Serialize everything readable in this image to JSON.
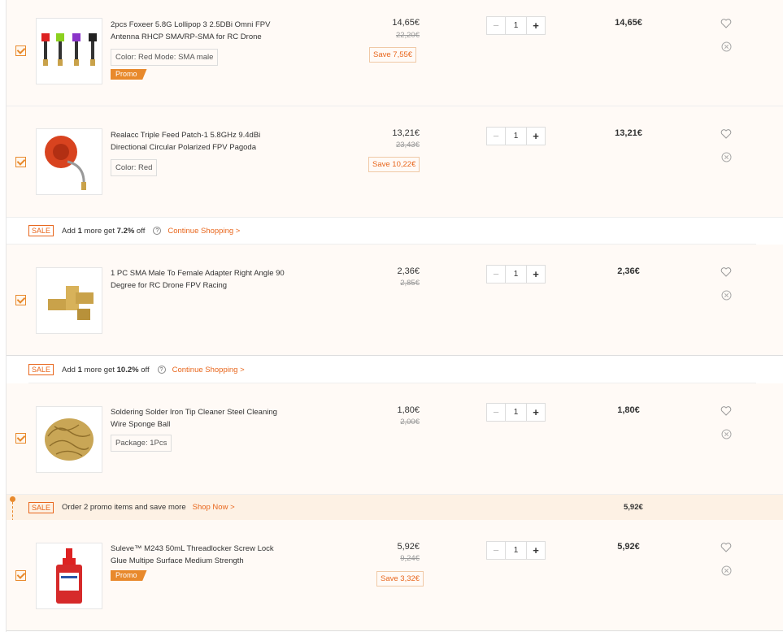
{
  "items": [
    {
      "title": "2pcs Foxeer 5.8G Lollipop 3 2.5DBi Omni FPV Antenna RHCP SMA/RP-SMA for RC Drone",
      "variant": "Color: Red Mode: SMA male",
      "promo": "Promo",
      "price": "14,65€",
      "old_price": "22,20€",
      "save": "Save 7,55€",
      "qty": "1",
      "subtotal": "14,65€",
      "thumb_icon": "antenna-set-image"
    },
    {
      "title": "Realacc Triple Feed Patch-1 5.8GHz 9.4dBi Directional Circular Polarized FPV Pagoda",
      "variant": "Color: Red",
      "price": "13,21€",
      "old_price": "23,43€",
      "save": "Save 10,22€",
      "qty": "1",
      "subtotal": "13,21€",
      "thumb_icon": "patch-antenna-image"
    },
    {
      "title": "1 PC SMA Male To Female Adapter Right Angle 90 Degree for RC Drone FPV Racing",
      "price": "2,36€",
      "old_price": "2,85€",
      "qty": "1",
      "subtotal": "2,36€",
      "thumb_icon": "sma-adapter-image"
    },
    {
      "title": "Soldering Solder Iron Tip Cleaner Steel Cleaning Wire Sponge Ball",
      "variant": "Package: 1Pcs",
      "price": "1,80€",
      "old_price": "2,00€",
      "qty": "1",
      "subtotal": "1,80€",
      "thumb_icon": "wire-sponge-image"
    },
    {
      "title": "Suleve™ M243 50mL Threadlocker Screw Lock Glue Multipe Surface Medium Strength",
      "promo": "Promo",
      "price": "5,92€",
      "old_price": "9,24€",
      "save": "Save 3,32€",
      "qty": "1",
      "subtotal": "5,92€",
      "thumb_icon": "threadlocker-bottle-image"
    }
  ],
  "sale_bars": [
    {
      "badge": "SALE",
      "prefix": "Add ",
      "count": "1",
      "middle": " more get ",
      "discount": "7.2%",
      "suffix": " off",
      "link": "Continue Shopping >"
    },
    {
      "badge": "SALE",
      "prefix": "Add ",
      "count": "1",
      "middle": " more get ",
      "discount": "10.2%",
      "suffix": " off",
      "link": "Continue Shopping >"
    }
  ],
  "promo_bar": {
    "badge": "SALE",
    "text": "Order 2 promo items and save more",
    "link": "Shop Now >",
    "total": "5,92€"
  },
  "controls": {
    "minus": "−",
    "plus": "+",
    "help": "?"
  },
  "colors": {
    "accent": "#e8661c",
    "promo": "#e8892c",
    "row_bg": "#fffaf6",
    "promo_bg": "#fdf1e4"
  }
}
